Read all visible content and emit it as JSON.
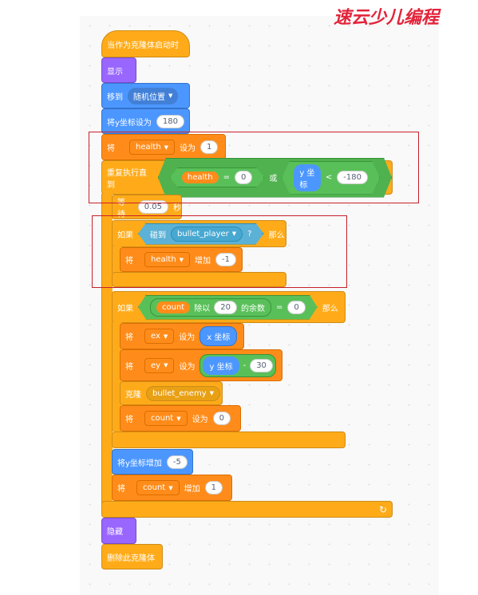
{
  "logo": "速云少儿编程",
  "blocks": {
    "hat": "当作为克隆体启动时",
    "show": "显示",
    "goto": {
      "label": "移到",
      "target": "随机位置"
    },
    "sety": {
      "label": "将y坐标设为",
      "value": "180"
    },
    "sethealth": {
      "label": "将",
      "var": "health",
      "op": "设为",
      "value": "1"
    },
    "repeat": {
      "label": "重复执行直到",
      "var": "health",
      "eq": "=",
      "val": "0",
      "or": "或",
      "ypos": "y 坐标",
      "lt": "<",
      "lim": "-180"
    },
    "wait": {
      "label": "等待",
      "value": "0.05",
      "unit": "秒"
    },
    "if1": {
      "if": "如果",
      "touch": "碰到",
      "target": "bullet_player",
      "q": "?",
      "then": "那么"
    },
    "chhealth": {
      "label": "将",
      "var": "health",
      "op": "增加",
      "value": "-1"
    },
    "if2": {
      "if": "如果",
      "var": "count",
      "mod": "除以",
      "n": "20",
      "rem": "的余数",
      "eq": "=",
      "val": "0",
      "then": "那么"
    },
    "setex": {
      "label": "将",
      "var": "ex",
      "op": "设为",
      "val": "x 坐标"
    },
    "setey": {
      "label": "将",
      "var": "ey",
      "op": "设为",
      "val": "y 坐标",
      "minus": "-",
      "n": "30"
    },
    "clone": {
      "label": "克隆",
      "target": "bullet_enemy"
    },
    "setcount": {
      "label": "将",
      "var": "count",
      "op": "设为",
      "value": "0"
    },
    "changey": {
      "label": "将y坐标增加",
      "value": "-5"
    },
    "chcount": {
      "label": "将",
      "var": "count",
      "op": "增加",
      "value": "1"
    },
    "hide": "隐藏",
    "delete": "删除此克隆体"
  }
}
